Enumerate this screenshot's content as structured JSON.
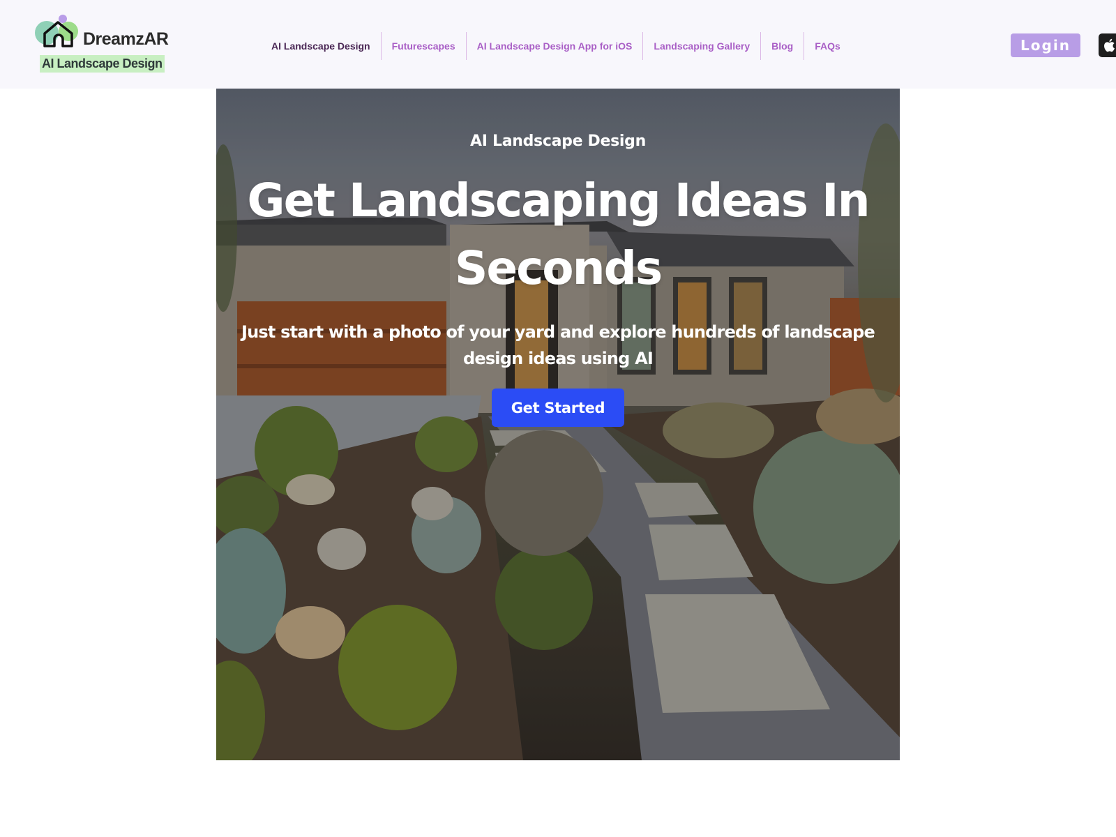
{
  "header": {
    "brand": "DreamzAR",
    "tagline": "AI Landscape Design",
    "nav": [
      {
        "label": "AI Landscape Design",
        "active": true
      },
      {
        "label": "Futurescapes",
        "active": false
      },
      {
        "label": "AI Landscape Design App for iOS",
        "active": false
      },
      {
        "label": "Landscaping Gallery",
        "active": false
      },
      {
        "label": "Blog",
        "active": false
      },
      {
        "label": "FAQs",
        "active": false
      }
    ],
    "login_label": "Login",
    "app_store_icon": "apple-icon"
  },
  "hero": {
    "eyebrow": "AI Landscape Design",
    "title": "Get Landscaping Ideas In Seconds",
    "subtitle": "Just start with a photo of your yard and explore hundreds of landscape design ideas using AI",
    "cta_label": "Get Started",
    "image_description": "Modern single-story house with wood garage door and xeriscape front yard with grasses, boulders and stepping-stone path"
  },
  "colors": {
    "header_bg": "#f8f7fc",
    "nav_link": "#a95fc6",
    "nav_active": "#4a2755",
    "login_bg": "#b89de6",
    "tagline_bg": "#c8efc2",
    "cta_bg": "#2b4cf5"
  }
}
